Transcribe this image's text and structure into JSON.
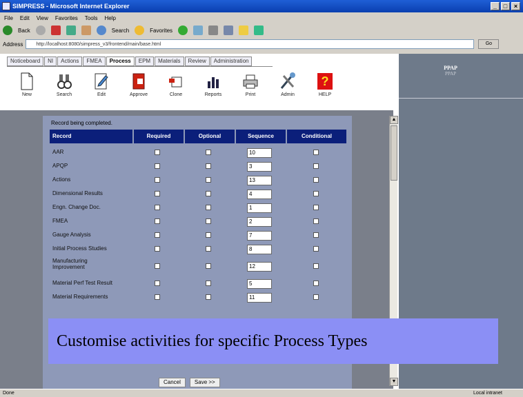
{
  "window": {
    "title": "SIMPRESS - Microsoft Internet Explorer",
    "buttons": [
      "_",
      "□",
      "×"
    ]
  },
  "menu": [
    "File",
    "Edit",
    "View",
    "Favorites",
    "Tools",
    "Help"
  ],
  "toolbar": {
    "back": "Back",
    "search": "Search",
    "favorites": "Favorites"
  },
  "address": {
    "label": "Address",
    "url": "http://localhost:8080/simpress_v3/frontend/main/base.html",
    "go": "Go"
  },
  "tabs": [
    "Noticeboard",
    "NI",
    "Actions",
    "FMEA",
    "Process",
    "EPM",
    "Materials",
    "Review",
    "Administration"
  ],
  "active_tab": "Process",
  "right_panel": {
    "title": "PPAP",
    "subtitle": "PPAP"
  },
  "icons": [
    "New",
    "Search",
    "Edit",
    "Approve",
    "Clone",
    "Reports",
    "Print",
    "Admin",
    "HELP"
  ],
  "form": {
    "caption": "Record being completed.",
    "headers": [
      "Record",
      "Required",
      "Optional",
      "Sequence",
      "Conditional"
    ],
    "rows": [
      {
        "label": "AAR",
        "seq": "10",
        "tall": false
      },
      {
        "label": "APQP",
        "seq": "3",
        "tall": false
      },
      {
        "label": "Actions",
        "seq": "13",
        "tall": false
      },
      {
        "label": "Dimensional Results",
        "seq": "4",
        "tall": false
      },
      {
        "label": "Engn. Change Doc.",
        "seq": "1",
        "tall": false
      },
      {
        "label": "FMEA",
        "seq": "2",
        "tall": false
      },
      {
        "label": "Gauge Analysis",
        "seq": "7",
        "tall": false
      },
      {
        "label": "Initial Process Studies",
        "seq": "8",
        "tall": false
      },
      {
        "label": "Manufacturing Improvement",
        "seq": "12",
        "tall": true
      },
      {
        "label": "Material Perf Test Result",
        "seq": "5",
        "tall": false
      },
      {
        "label": "Material Requirements",
        "seq": "11",
        "tall": false
      }
    ],
    "buttons": [
      "Cancel",
      "Save >>"
    ]
  },
  "overlay": "Customise activities for specific Process Types",
  "status": {
    "left": "Done",
    "zone": "Local intranet"
  }
}
